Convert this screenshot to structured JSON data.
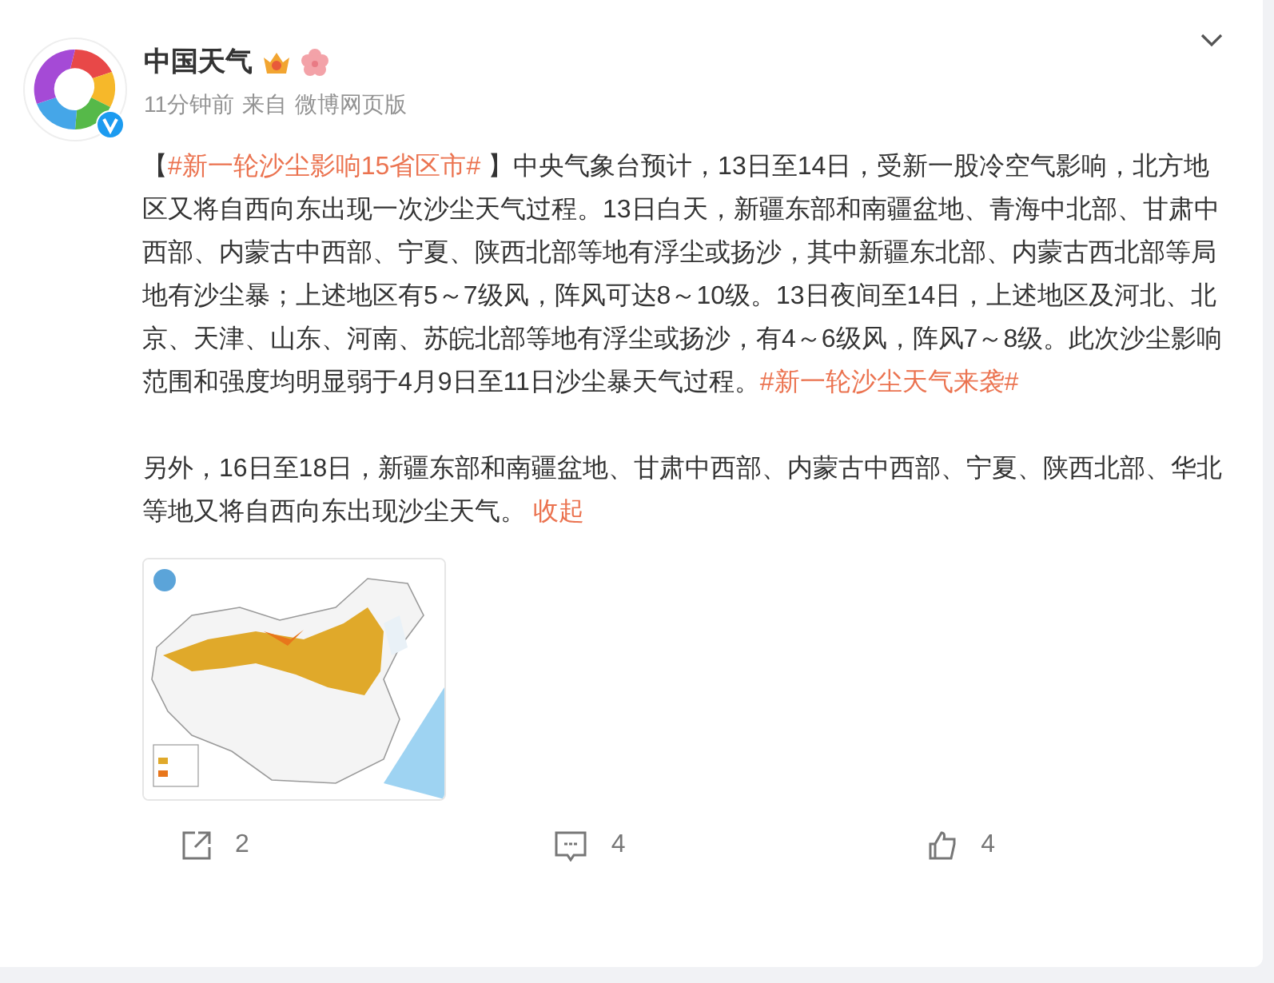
{
  "author": {
    "name": "中国天气",
    "time": "11分钟前",
    "source_label": "来自",
    "source": "微博网页版",
    "verified": true
  },
  "paragraphs": [
    {
      "parts": [
        {
          "kind": "text",
          "text": "【"
        },
        {
          "kind": "topic",
          "text": "#新一轮沙尘影响15省区市#"
        },
        {
          "kind": "text",
          "text": " 】中央气象台预计，13日至14日，受新一股冷空气影响，北方地区又将自西向东出现一次沙尘天气过程。13日白天，新疆东部和南疆盆地、青海中北部、甘肃中西部、内蒙古中西部、宁夏、陕西北部等地有浮尘或扬沙，其中新疆东北部、内蒙古西北部等局地有沙尘暴；上述地区有5～7级风，阵风可达8～10级。13日夜间至14日，上述地区及河北、北京、天津、山东、河南、苏皖北部等地有浮尘或扬沙，有4～6级风，阵风7～8级。此次沙尘影响范围和强度均明显弱于4月9日至11日沙尘暴天气过程。"
        },
        {
          "kind": "topic",
          "text": "#新一轮沙尘天气来袭#"
        }
      ]
    },
    {
      "parts": [
        {
          "kind": "text",
          "text": "另外，16日至18日，新疆东部和南疆盆地、甘肃中西部、内蒙古中西部、宁夏、陕西北部、华北等地又将自西向东出现沙尘天气。 "
        },
        {
          "kind": "link",
          "text": "收起"
        }
      ]
    }
  ],
  "actions": [
    {
      "kind": "repost",
      "count": "2"
    },
    {
      "kind": "comment",
      "count": "4"
    },
    {
      "kind": "like",
      "count": "4"
    }
  ]
}
